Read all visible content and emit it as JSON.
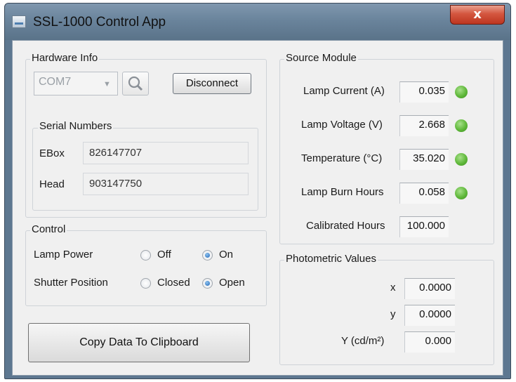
{
  "window": {
    "title": "SSL-1000 Control App",
    "close_glyph": "x"
  },
  "hardware_info": {
    "label": "Hardware Info",
    "port": "COM7",
    "search_icon": "magnifier-icon",
    "disconnect_label": "Disconnect",
    "serial_numbers": {
      "label": "Serial Numbers",
      "ebox_label": "EBox",
      "ebox_value": "826147707",
      "head_label": "Head",
      "head_value": "903147750"
    }
  },
  "control": {
    "label": "Control",
    "lamp_power": {
      "label": "Lamp Power",
      "off": "Off",
      "on": "On",
      "selected": "On"
    },
    "shutter": {
      "label": "Shutter Position",
      "closed": "Closed",
      "open": "Open",
      "selected": "Open"
    }
  },
  "copy_button": "Copy Data To Clipboard",
  "source_module": {
    "label": "Source Module",
    "rows": [
      {
        "label": "Lamp Current (A)",
        "value": "0.035",
        "status_color": "#5fb83a"
      },
      {
        "label": "Lamp Voltage (V)",
        "value": "2.668",
        "status_color": "#5fb83a"
      },
      {
        "label": "Temperature (°C)",
        "value": "35.020",
        "status_color": "#5fb83a"
      },
      {
        "label": "Lamp Burn Hours",
        "value": "0.058",
        "status_color": "#5fb83a"
      },
      {
        "label": "Calibrated Hours",
        "value": "100.000"
      }
    ]
  },
  "photometric": {
    "label": "Photometric Values",
    "rows": [
      {
        "label": "x",
        "value": "0.0000"
      },
      {
        "label": "y",
        "value": "0.0000"
      },
      {
        "label": "Y (cd/m²)",
        "value": "0.000"
      }
    ]
  }
}
